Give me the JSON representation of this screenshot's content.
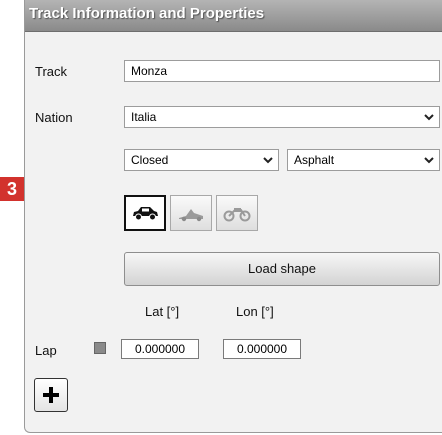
{
  "window": {
    "title": "Track Information and Properties"
  },
  "track": {
    "label": "Track",
    "value": "Monza"
  },
  "nation": {
    "label": "Nation",
    "selected": "Italia"
  },
  "circuit_type": {
    "selected": "Closed"
  },
  "surface": {
    "selected": "Asphalt"
  },
  "vehicle_buttons": [
    {
      "icon": "car-icon",
      "selected": true
    },
    {
      "icon": "kart-icon",
      "selected": false
    },
    {
      "icon": "motorbike-icon",
      "selected": false
    }
  ],
  "load_shape": {
    "label": "Load shape"
  },
  "coords": {
    "lat_header": "Lat [°]",
    "lon_header": "Lon [°]",
    "row_label": "Lap",
    "lat_value": "0.000000",
    "lon_value": "0.000000"
  },
  "add_button": {
    "label": "+"
  },
  "step_badge": {
    "label": "3",
    "color": "#d2322d"
  }
}
